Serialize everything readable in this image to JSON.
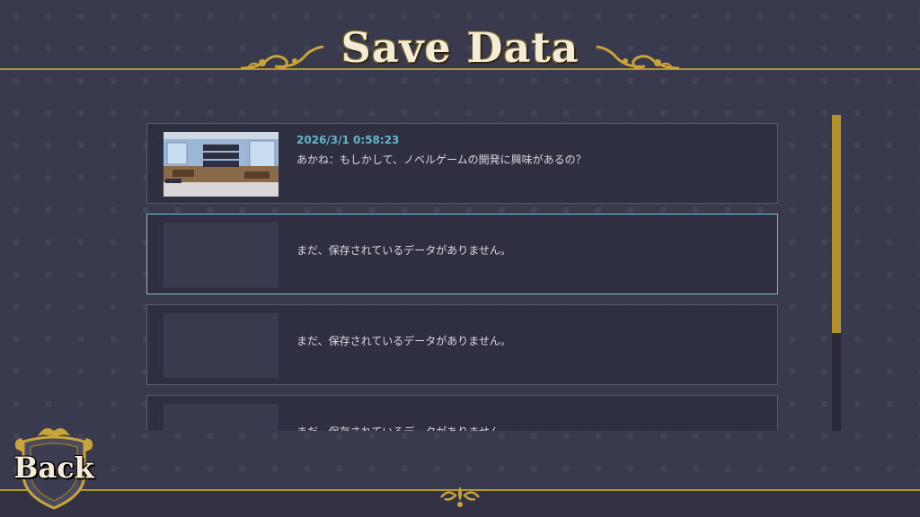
{
  "header": {
    "title": "Save Data"
  },
  "slots": [
    {
      "date": "2026/3/1 0:58:23",
      "text": "あかね：もしかして、ノベルゲームの開発に興味があるの？",
      "has_data": true
    },
    {
      "text": "まだ、保存されているデータがありません。",
      "has_data": false
    },
    {
      "text": "まだ、保存されているデータがありません。",
      "has_data": false
    },
    {
      "text": "まだ、保存されているデータがありません。",
      "has_data": false
    }
  ],
  "footer": {
    "back_label": "Back"
  },
  "scroll": {
    "position": 0.0,
    "visible_fraction": 0.69
  },
  "colors": {
    "accent_gold": "#b5952e",
    "selected_border": "#6fc6d6",
    "date_text": "#5fb6c9"
  },
  "icons": {
    "header_left": "gold-flourish-icon",
    "header_right": "gold-flourish-icon",
    "back_crest": "shield-crest-icon",
    "bottom": "gold-ornament-icon"
  }
}
